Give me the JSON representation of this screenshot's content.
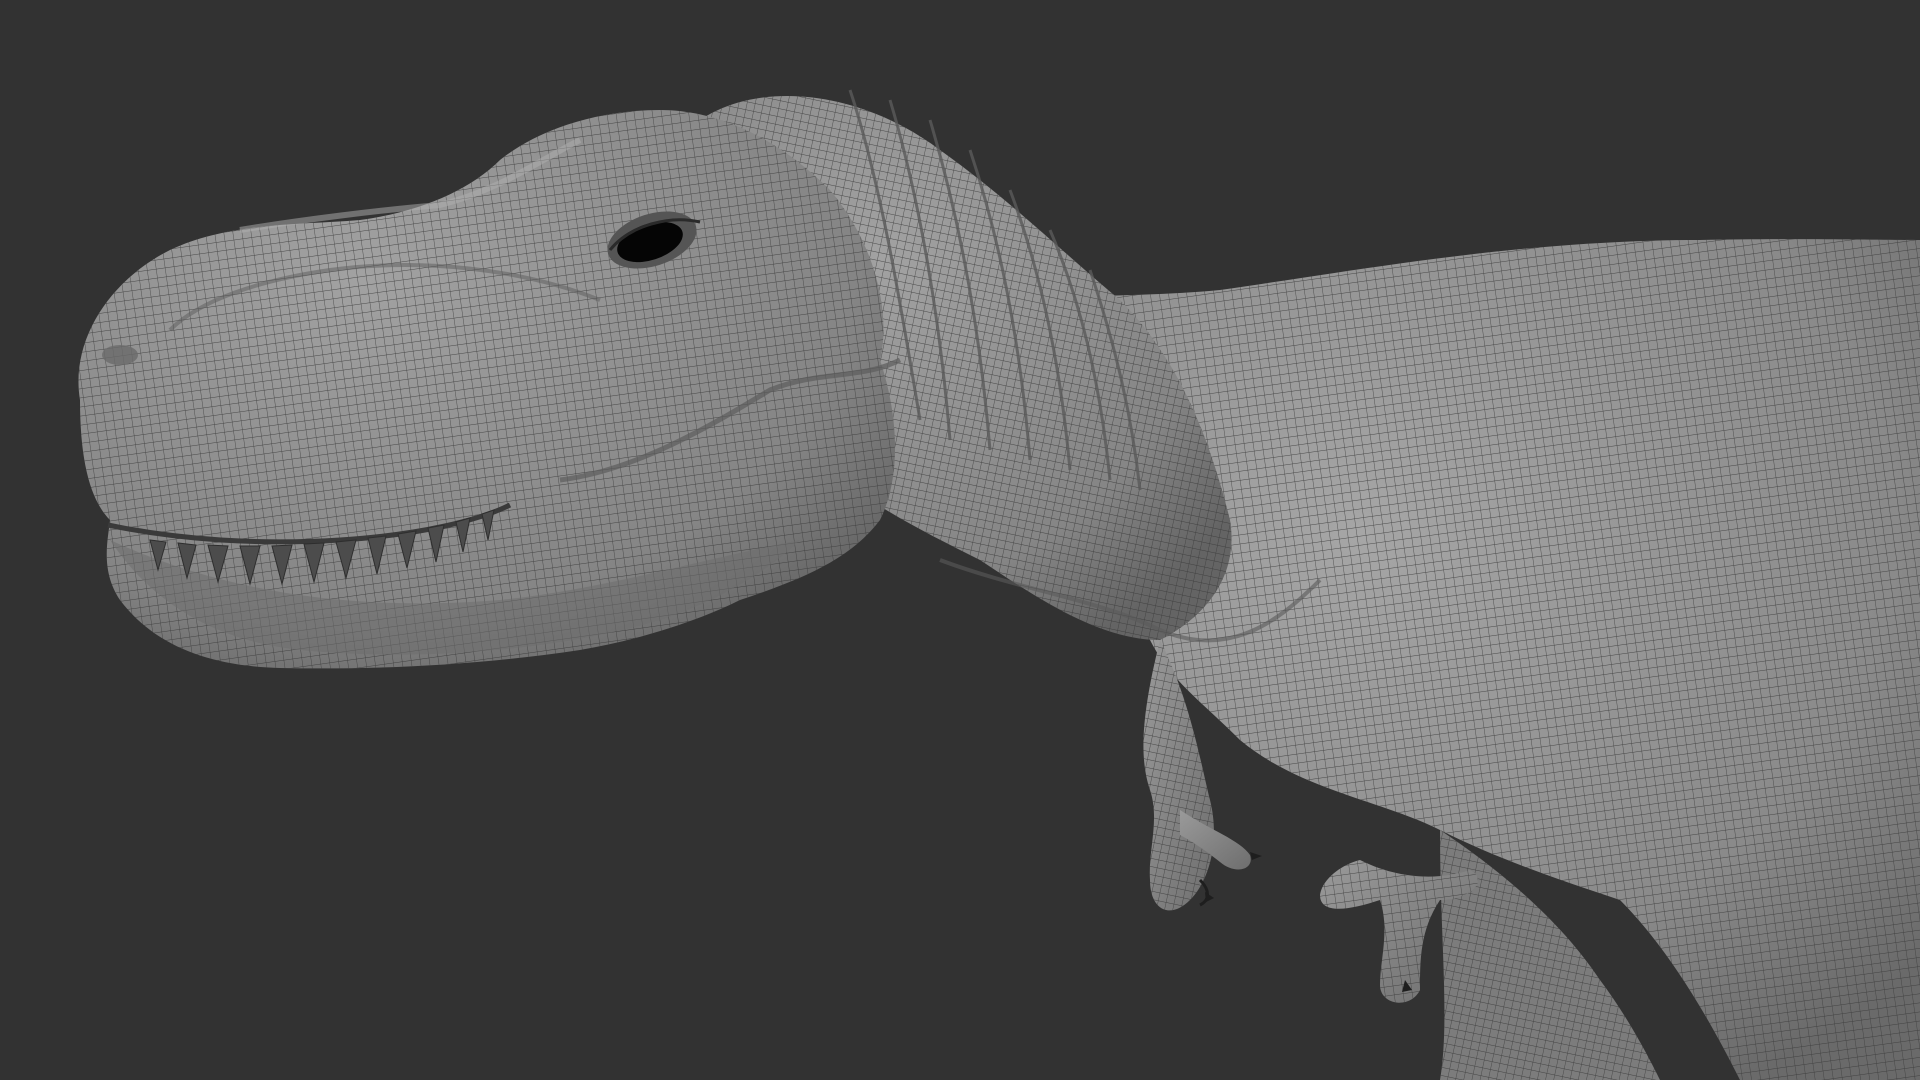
{
  "scene": {
    "subject": "t-rex-wireframe-model",
    "background_color": "#323232",
    "model_color": "#8c8c8c",
    "model_highlight_color": "#a8a8a8",
    "model_shadow_color": "#5e5e5e",
    "wire_color": "#3a3a3a",
    "eye_color": "#050505",
    "claw_color": "#1e1e1e"
  }
}
